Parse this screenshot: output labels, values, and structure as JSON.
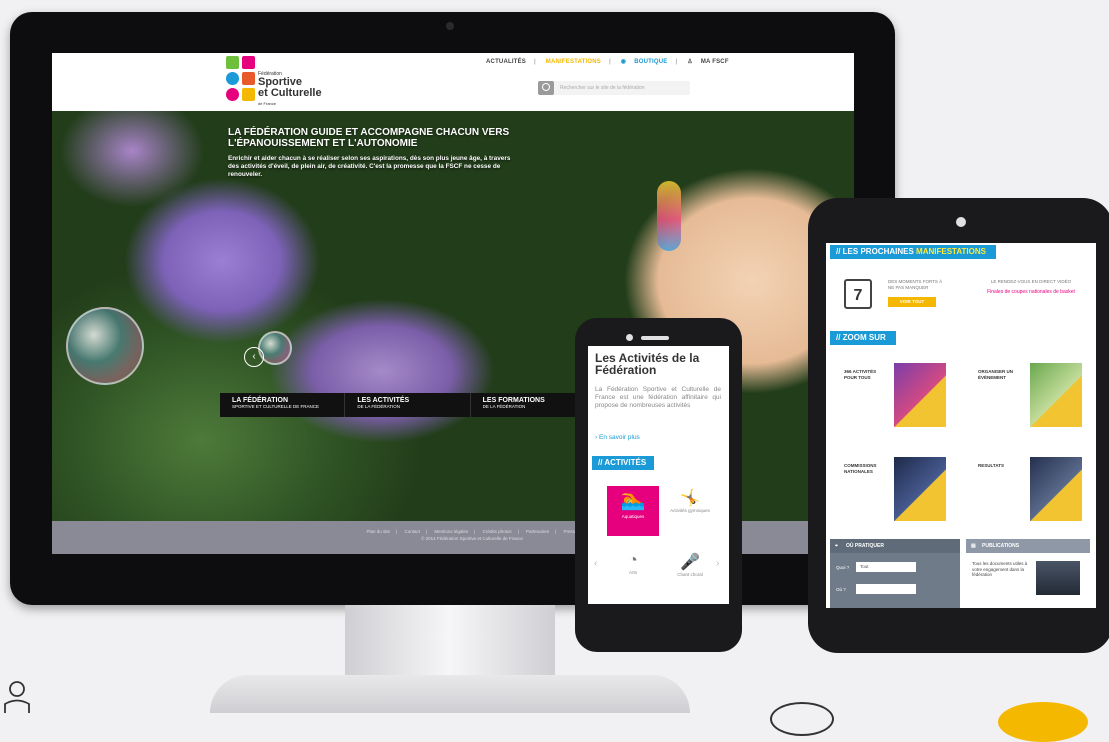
{
  "desktop": {
    "logo": {
      "line1": "Fédération",
      "line2": "Sportive",
      "line3": "et Culturelle",
      "line4": "de France"
    },
    "topnav": {
      "news": "ACTUALITÉS",
      "events": "MANIFESTATIONS",
      "shop": "BOUTIQUE",
      "account": "MA FSCF"
    },
    "search": {
      "placeholder": "Rechercher sur le site de la fédération"
    },
    "hero": {
      "title": "LA FÉDÉRATION GUIDE ET ACCOMPAGNE CHACUN VERS L'ÉPANOUISSEMENT ET L'AUTONOMIE",
      "description": "Enrichir et aider chacun à se réaliser selon ses aspirations, dès son plus jeune âge, à travers des activités d'éveil, de plein air, de créativité. C'est la promesse que la FSCF ne cesse de renouveler."
    },
    "feature_tabs": [
      {
        "title": "LA FÉDÉRATION",
        "subtitle": "SPORTIVE ET CULTURELLE DE FRANCE"
      },
      {
        "title": "LES ACTIVITÉS",
        "subtitle": "DE LA FÉDÉRATION"
      },
      {
        "title": "LES FORMATIONS",
        "subtitle": "DE LA FÉDÉRATION"
      }
    ],
    "footer": {
      "links": [
        "Plan du site",
        "Contact",
        "Mentions légales",
        "Crédits photos",
        "Partenaires",
        "Presse"
      ],
      "copyright": "© 2014 Fédération Sportive et Culturelle de France"
    }
  },
  "tablet": {
    "events_header": {
      "part1": "// LES PROCHAINES",
      "part2": "MANIFESTATIONS"
    },
    "calendar_day": "7",
    "events_text": "DES MOMENTS FORTS À NE PAS MANQUER",
    "events_button": "VOIR TOUT",
    "event_teaser_label": "LE RENDEZ-VOUS EN DIRECT VIDÉO",
    "event_teaser_text": "Finales de coupes nationales de basket",
    "zoom_header": "// ZOOM SUR",
    "zoom_items": [
      {
        "title": "366 ACTIVITÉS POUR TOUS"
      },
      {
        "title": "ORGANISER UN ÉVÈNEMENT"
      },
      {
        "title": "COMMISSIONS NATIONALES"
      },
      {
        "title": "RESULTATS"
      }
    ],
    "practical": {
      "title": "OÙ PRATIQUER",
      "what_label": "Quoi ?",
      "what_value": "Tout",
      "where_label": "Où ?"
    },
    "publications": {
      "title": "PUBLICATIONS",
      "text": "Tous les documents utiles à votre engagement dans la fédération"
    }
  },
  "phone": {
    "title": "Les Activités de la Fédération",
    "paragraph": "La Fédération Sportive et Culturelle de France est une fédération affinitaire qui propose de nombreuses activités",
    "more_link": "En savoir plus",
    "activities_header": "// ACTIVITÉS",
    "activities": [
      {
        "label": "Aquatiques",
        "icon": "swimmer-icon"
      },
      {
        "label": "Activités gymniques",
        "icon": "gymnast-icon"
      },
      {
        "label": "Arts",
        "icon": "palette-icon"
      },
      {
        "label": "Chant choral",
        "icon": "singer-icon"
      }
    ]
  },
  "colors": {
    "accent_blue": "#1a9ad6",
    "accent_yellow": "#f4b800",
    "accent_pink": "#e6007e"
  }
}
